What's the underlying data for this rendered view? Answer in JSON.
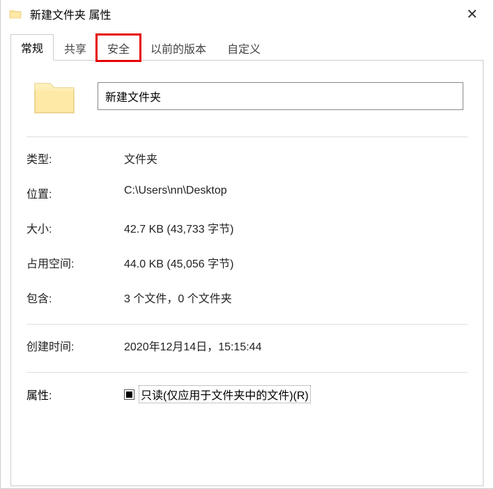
{
  "window": {
    "title": "新建文件夹 属性"
  },
  "tabs": {
    "general": "常规",
    "share": "共享",
    "security": "安全",
    "previous": "以前的版本",
    "custom": "自定义"
  },
  "general": {
    "name": "新建文件夹",
    "type_label": "类型:",
    "type_value": "文件夹",
    "location_label": "位置:",
    "location_value": "C:\\Users\\nn\\Desktop",
    "size_label": "大小:",
    "size_value": "42.7 KB (43,733 字节)",
    "sizeondisk_label": "占用空间:",
    "sizeondisk_value": "44.0 KB (45,056 字节)",
    "contains_label": "包含:",
    "contains_value": "3 个文件，0 个文件夹",
    "created_label": "创建时间:",
    "created_value": "2020年12月14日，15:15:44",
    "attributes_label": "属性:",
    "readonly_label": "只读(仅应用于文件夹中的文件)(R)"
  }
}
